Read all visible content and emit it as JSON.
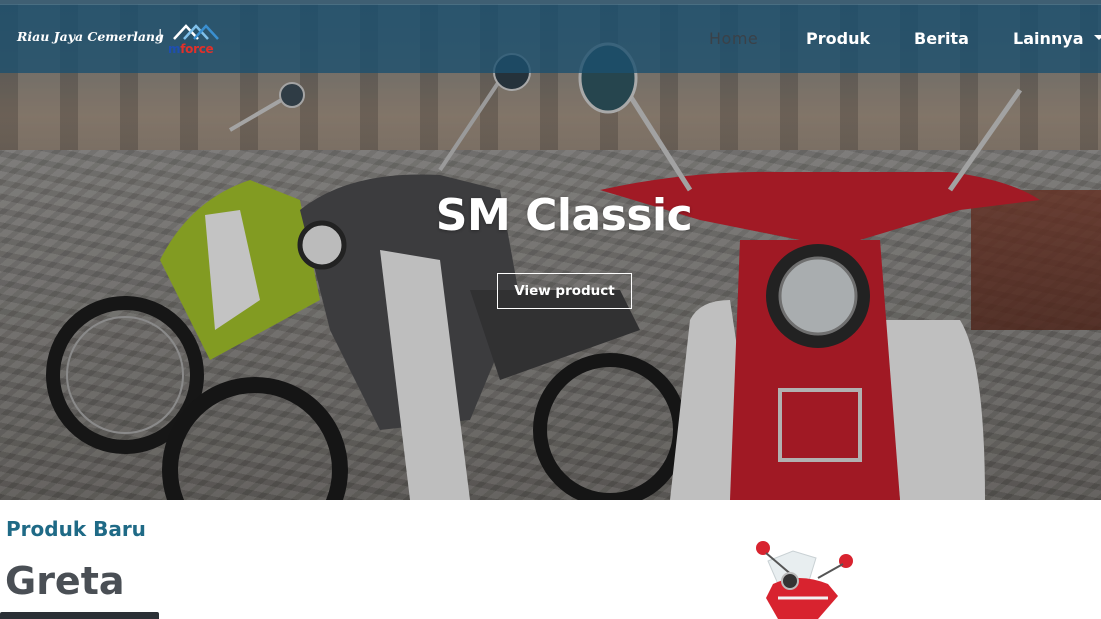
{
  "navbar": {
    "brand": "Riau Jaya Cemerlang",
    "separator": "|",
    "logo_m": "m",
    "logo_force": "force",
    "items": [
      {
        "label": "Home",
        "active": true
      },
      {
        "label": "Produk",
        "active": false
      },
      {
        "label": "Berita",
        "active": false
      },
      {
        "label": "Lainnya",
        "active": false
      }
    ]
  },
  "hero": {
    "title": "SM Classic",
    "button_label": "View product"
  },
  "new_products": {
    "section_label": "Produk Baru",
    "product_name": "Greta"
  },
  "colors": {
    "navbar": "#1b4f6e",
    "section_label": "#1f6a86",
    "product_name": "#4a4f55",
    "logo_blue": "#1e4fb0",
    "logo_red": "#e0302a"
  },
  "icons": {
    "logo": "mforce-roof-logo",
    "dropdown": "caret-down-icon"
  }
}
